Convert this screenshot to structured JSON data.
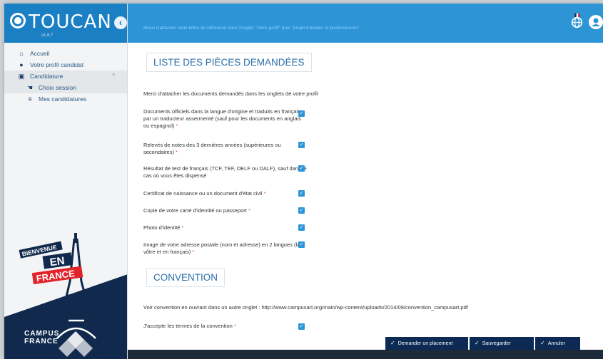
{
  "app": {
    "logo_text": "TOUCAN",
    "version": "v1.8.7",
    "collapse_icon": "chevron-left-icon"
  },
  "topbar": {
    "message": "Merci d'attacher cette lettre de référence dans l'onglet \"Votre profil\" puis \"projet d'études et professionnel\"",
    "icons": [
      "globe-icon",
      "user-icon"
    ]
  },
  "sidebar": {
    "items": [
      {
        "label": "Accueil",
        "icon": "home-icon"
      },
      {
        "label": "Votre profil candidat",
        "icon": "user-icon"
      },
      {
        "label": "Candidature",
        "icon": "folder-icon"
      },
      {
        "label": "Choix session",
        "icon": "hand-icon"
      },
      {
        "label": "Mes candidatures",
        "icon": "list-icon"
      }
    ],
    "poster": {
      "bienvenue": "BIENVENUE",
      "en": "EN",
      "france": "FRANCE"
    },
    "campus_logo": [
      "CAMPUS",
      "FRANCE"
    ]
  },
  "main": {
    "pieces_title": "LISTE DES PIÈCES DEMANDÉES",
    "pieces_intro": "Merci d'attacher les documents demandés dans les onglets de votre profil",
    "documents": [
      {
        "label": "Documents officiels dans la langue d'origine et traduits en français par un traducteur assermenté (sauf pour les documents en anglais ou espagnol)",
        "required": "*",
        "checked": true
      },
      {
        "label": "Relevés de notes des 3 dernières années (supérieures ou secondaires)",
        "required": "*",
        "checked": true
      },
      {
        "label": "Résultat de test de français (TCF, TEF, DELF ou DALF), sauf dans le cas où vous êtes dispensé",
        "required": "",
        "checked": true
      },
      {
        "label": "Certificat de naissance ou un document d'état civil",
        "required": "*",
        "checked": true
      },
      {
        "label": "Copie de votre carte d'identité ou passeport",
        "required": "*",
        "checked": true
      },
      {
        "label": "Photo d'identité",
        "required": "*",
        "checked": true
      },
      {
        "label": "Image de votre adresse postale (nom et adresse) en 2 langues (la vôtre et en français)",
        "required": "*",
        "checked": true
      }
    ],
    "convention_title": "CONVENTION",
    "convention_text": "Voir convention en ouvrant dans un autre onglet : http://www.campusart.org/main/wp-content/uploads/2014/09/convention_campusart.pdf",
    "accept_label": "J'accepte les termes de la convention",
    "accept_required": "*",
    "accept_checked": true
  },
  "actions": {
    "request_label": "Demander un placement",
    "save_label": "Sauvegarder",
    "cancel_label": "Annuler"
  },
  "colors": {
    "primary": "#2d94d6",
    "logo_bg": "#1b7fc4",
    "button_bg": "#0d2a55",
    "required": "#d9534f",
    "title_text": "#2a6fa8"
  }
}
